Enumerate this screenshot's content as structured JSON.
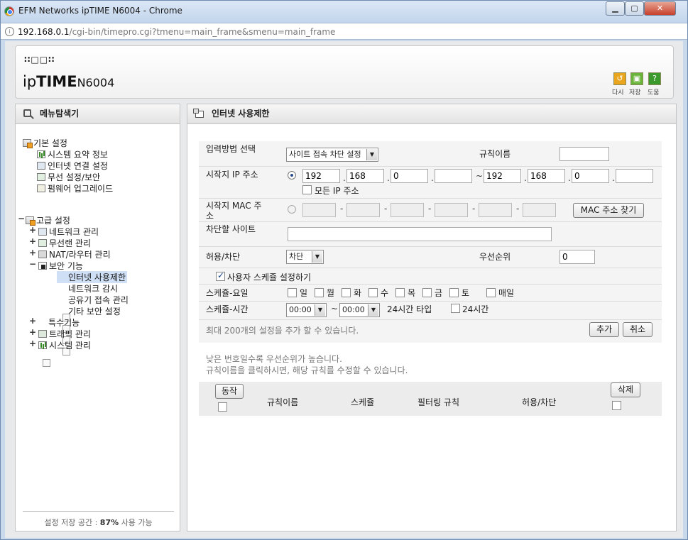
{
  "window": {
    "title": "EFM Networks ipTIME N6004 - Chrome",
    "url_host": "192.168.0.1",
    "url_path": "/cgi-bin/timepro.cgi?tmenu=main_frame&smenu=main_frame"
  },
  "header": {
    "logo_dots": "∷□□∷",
    "logo_ip": "ip",
    "logo_time": "TIME",
    "logo_model": "N6004",
    "buttons": [
      {
        "label": "다시",
        "color": "#e8a51d"
      },
      {
        "label": "저장",
        "color": "#6ab43c"
      },
      {
        "label": "도움",
        "color": "#3c9a2c"
      }
    ]
  },
  "sidebar": {
    "title": "메뉴탐색기",
    "basic_title": "기본 설정",
    "basic_items": [
      "시스템 요약 정보",
      "인터넷 연결 설정",
      "무선 설정/보안",
      "펌웨어 업그레이드"
    ],
    "advanced_title": "고급 설정",
    "advanced_items": [
      "네트워크 관리",
      "무선랜 관리",
      "NAT/라우터 관리",
      "보안 기능"
    ],
    "security_items": [
      "인터넷 사용제한",
      "네트워크 감시",
      "공유기 접속 관리",
      "기타 보안 설정"
    ],
    "advanced_items_after": [
      "특수기능",
      "트래픽 관리",
      "시스템 관리"
    ],
    "storage_prefix": "설정 저장 공간 : ",
    "storage_percent": "87%",
    "storage_suffix": " 사용 가능"
  },
  "main": {
    "title": "인터넷 사용제한",
    "form": {
      "input_method_label": "입력방법 선택",
      "input_method_value": "사이트 접속 차단 설정",
      "rule_name_label": "규칙이름",
      "rule_name_value": "",
      "start_ip_label": "시작지 IP 주소",
      "start_ip": [
        "192",
        "168",
        "0",
        ""
      ],
      "end_ip": [
        "192",
        "168",
        "0",
        ""
      ],
      "tilde": "~",
      "dot": ".",
      "all_ip_label": "모든 IP 주소",
      "start_mac_label": "시작지 MAC 주소",
      "mac_sep": "-",
      "mac_find_button": "MAC 주소 찾기",
      "block_site_label": "차단할 사이트",
      "block_site_value": "",
      "allow_block_label": "허용/차단",
      "allow_block_value": "차단",
      "priority_label": "우선순위",
      "priority_value": "0",
      "use_schedule_label": "사용자 스케쥴 설정하기",
      "schedule_day_label": "스케쥴-요일",
      "days": [
        "일",
        "월",
        "화",
        "수",
        "목",
        "금",
        "토"
      ],
      "daily_label": "매일",
      "schedule_time_label": "스케쥴-시간",
      "time_start": "00:00",
      "time_end": "00:00",
      "time_24_type": "24시간 타입",
      "time_24_label": "24시간",
      "max_note": "최대 200개의 설정을 추가 할 수 있습니다.",
      "add_button": "추가",
      "cancel_button": "취소"
    },
    "notes": [
      "낮은 번호일수록 우선순위가 높습니다.",
      "규칙이름을 클릭하시면, 해당 규칙를 수정할 수 있습니다."
    ],
    "table": {
      "action_button": "동작",
      "columns": [
        "규칙이름",
        "스케쥴",
        "필터링 규칙",
        "허용/차단"
      ],
      "delete_button": "삭제"
    }
  }
}
